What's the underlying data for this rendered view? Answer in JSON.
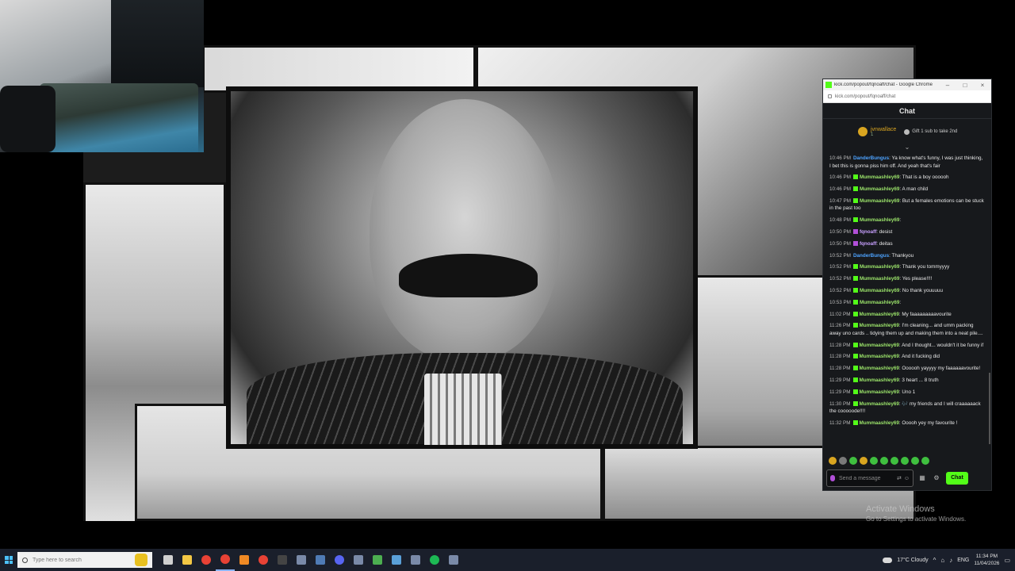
{
  "desktop": {
    "activate_title": "Activate Windows",
    "activate_sub": "Go to Settings to activate Windows."
  },
  "browser": {
    "title": "kick.com/popout/fqnoaff/chat - Google Chrome",
    "url": "kick.com/popout/fqnoaff/chat"
  },
  "chat": {
    "header": "Chat",
    "pinned": {
      "user": "jvnwallace",
      "count": "1",
      "gift_label": "Gift 1 sub to take 2nd"
    },
    "messages": [
      {
        "time": "10:46 PM",
        "user": "DanderBungus",
        "color": "#4da3ff",
        "badge": "",
        "text": "Ya know what's funny, I was just thinking, I bet this is gonna piss him off. And yeah that's fair"
      },
      {
        "time": "10:46 PM",
        "user": "Mummaashley69",
        "color": "#9be36a",
        "badge": "#53fc18",
        "text": "That is a boy oooooh"
      },
      {
        "time": "10:46 PM",
        "user": "Mummaashley69",
        "color": "#9be36a",
        "badge": "#53fc18",
        "text": "A man child"
      },
      {
        "time": "10:47 PM",
        "user": "Mummaashley69",
        "color": "#9be36a",
        "badge": "#53fc18",
        "text": "But a females emotions can be stuck in the past too"
      },
      {
        "time": "10:48 PM",
        "user": "Mummaashley69",
        "color": "#9be36a",
        "badge": "#53fc18",
        "text": ""
      },
      {
        "time": "10:50 PM",
        "user": "fqnoaff",
        "color": "#c8a0ff",
        "badge": "#b14fd8",
        "text": "desist"
      },
      {
        "time": "10:50 PM",
        "user": "fqnoaff",
        "color": "#c8a0ff",
        "badge": "#b14fd8",
        "text": "deitas"
      },
      {
        "time": "10:52 PM",
        "user": "DanderBungus",
        "color": "#4da3ff",
        "badge": "",
        "text": "Thankyou"
      },
      {
        "time": "10:52 PM",
        "user": "Mummaashley69",
        "color": "#9be36a",
        "badge": "#53fc18",
        "text": "Thank you tommyyyy"
      },
      {
        "time": "10:52 PM",
        "user": "Mummaashley69",
        "color": "#9be36a",
        "badge": "#53fc18",
        "text": "Yes please!!!!"
      },
      {
        "time": "10:52 PM",
        "user": "Mummaashley69",
        "color": "#9be36a",
        "badge": "#53fc18",
        "text": "No thank youuuuu"
      },
      {
        "time": "10:53 PM",
        "user": "Mummaashley69",
        "color": "#9be36a",
        "badge": "#53fc18",
        "text": ""
      },
      {
        "time": "11:02 PM",
        "user": "Mummaashley69",
        "color": "#9be36a",
        "badge": "#53fc18",
        "text": "My faaaaaaaaavourite"
      },
      {
        "time": "11:26 PM",
        "user": "Mummaashley69",
        "color": "#9be36a",
        "badge": "#53fc18",
        "text": "I'm cleaning... and umm packing away uno cards .. tidying them up and making them into a neat pile...."
      },
      {
        "time": "11:28 PM",
        "user": "Mummaashley69",
        "color": "#9be36a",
        "badge": "#53fc18",
        "text": "And I thought... wouldn't it be funny if"
      },
      {
        "time": "11:28 PM",
        "user": "Mummaashley69",
        "color": "#9be36a",
        "badge": "#53fc18",
        "text": "And it fucking did"
      },
      {
        "time": "11:28 PM",
        "user": "Mummaashley69",
        "color": "#9be36a",
        "badge": "#53fc18",
        "text": "Oooooh yayyyy my faaaaaavourite!"
      },
      {
        "time": "11:29 PM",
        "user": "Mummaashley69",
        "color": "#9be36a",
        "badge": "#53fc18",
        "text": "3 heart ... 8 truth"
      },
      {
        "time": "11:29 PM",
        "user": "Mummaashley69",
        "color": "#9be36a",
        "badge": "#53fc18",
        "text": "Uno 1"
      },
      {
        "time": "11:30 PM",
        "user": "Mummaashley69",
        "color": "#9be36a",
        "badge": "#53fc18",
        "text": "🎶 my friends and I will craaaaaack the cooooode!!!!"
      },
      {
        "time": "11:32 PM",
        "user": "Mummaashley69",
        "color": "#9be36a",
        "badge": "#53fc18",
        "text": "Ooooh yey my favourite !"
      }
    ],
    "input_placeholder": "Send a message",
    "send_label": "Chat"
  },
  "taskbar": {
    "search_placeholder": "Type here to search",
    "weather": "17°C  Cloudy",
    "lang": "ENG",
    "time": "11:34 PM",
    "date": "11/04/2026",
    "apps": [
      "task-view-icon",
      "file-explorer-icon",
      "chrome-icon",
      "chrome-icon",
      "browser-icon",
      "chrome-icon",
      "terminal-icon",
      "app-icon",
      "steam-icon",
      "discord-icon",
      "app-icon",
      "xbox-icon",
      "notes-icon",
      "app-icon",
      "spotify-icon",
      "app-icon"
    ]
  }
}
